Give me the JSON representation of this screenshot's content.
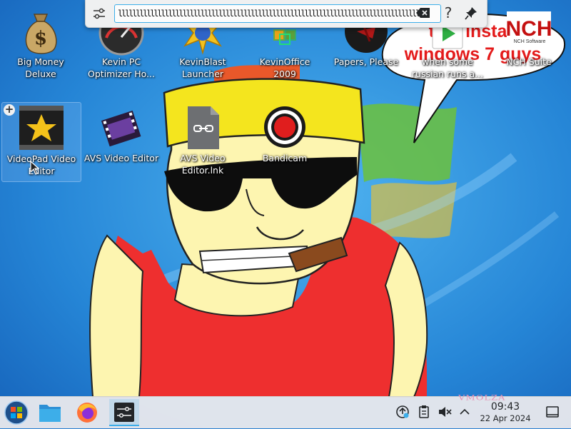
{
  "desktop": {
    "icons": [
      {
        "label": "Big Money Deluxe",
        "icon": "money-bag-icon"
      },
      {
        "label": "Kevin PC Optimizer Ho...",
        "icon": "gauge-icon"
      },
      {
        "label": "KevinBlast Launcher",
        "icon": "starburst-icon"
      },
      {
        "label": "KevinOffice 2009",
        "icon": "office-icon"
      },
      {
        "label": "Papers, Please",
        "icon": "papers-please-icon"
      },
      {
        "label": "when some russian runs a...",
        "icon": "video-file-icon"
      },
      {
        "label": "NCH Suite",
        "icon": "nch-logo-icon"
      },
      {
        "label": "VideoPad Video Editor",
        "icon": "videopad-icon"
      },
      {
        "label": "AVS Video Editor",
        "icon": "film-strip-icon"
      },
      {
        "label": "AVS Video Editor.lnk",
        "icon": "link-file-icon"
      },
      {
        "label": "Bandicam",
        "icon": "record-icon"
      }
    ],
    "wallpaper_text": "this install windows 7 guys",
    "nch_software_text": "NCH Software"
  },
  "krunner": {
    "query": "lllllllllllllllllllllllllllllllllllllllllllllllllllllllllllllllllllllllllllllllllllllllllllllllllllllllllllllllllllllllllllllllllllllllllllllllllll",
    "help_label": "?",
    "accent": "#3daee9"
  },
  "taskbar": {
    "apps": [
      {
        "name": "start-menu",
        "icon": "windows-logo-icon"
      },
      {
        "name": "file-manager",
        "icon": "folder-icon"
      },
      {
        "name": "firefox",
        "icon": "firefox-icon"
      },
      {
        "name": "krunner",
        "icon": "settings-sliders-icon"
      }
    ],
    "tray": [
      "updates-icon",
      "clipboard-icon",
      "volume-muted-icon",
      "expand-tray-icon"
    ],
    "time": "09:43",
    "date": "22 Apr 2024",
    "watermark": "VMOLZA"
  }
}
